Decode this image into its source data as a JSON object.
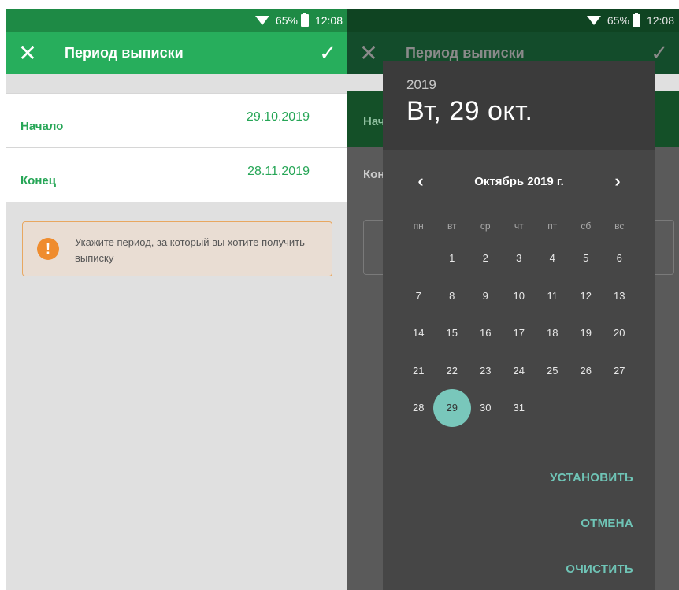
{
  "status": {
    "battery": "65%",
    "time": "12:08"
  },
  "appbar": {
    "title": "Период выписки"
  },
  "form": {
    "start_label": "Начало",
    "start_value": "29.10.2019",
    "end_label": "Конец",
    "end_value": "28.11.2019"
  },
  "notice": {
    "text": "Укажите период, за который вы хотите получить выписку"
  },
  "background_peek": {
    "start_label": "Нача",
    "end_label": "Кон"
  },
  "picker": {
    "year": "2019",
    "selected_date": "Вт, 29 окт.",
    "month_title": "Октябрь 2019 г.",
    "weekdays": [
      "пн",
      "вт",
      "ср",
      "чт",
      "пт",
      "сб",
      "вс"
    ],
    "first_weekday_offset": 1,
    "days_in_month": 31,
    "selected_day": 29,
    "actions": {
      "set": "УСТАНОВИТЬ",
      "cancel": "ОТМЕНА",
      "clear": "ОЧИСТИТЬ"
    }
  },
  "colors": {
    "primary_green": "#27ae5c",
    "status_green": "#1e8a45",
    "accent_teal": "#6fc4b6",
    "selection_teal": "#79c7bb",
    "warning_orange": "#ef8c2e"
  },
  "icons": {
    "close": "close-icon",
    "confirm": "check-icon",
    "warning": "exclamation-icon",
    "prev": "chevron-left-icon",
    "next": "chevron-right-icon"
  }
}
